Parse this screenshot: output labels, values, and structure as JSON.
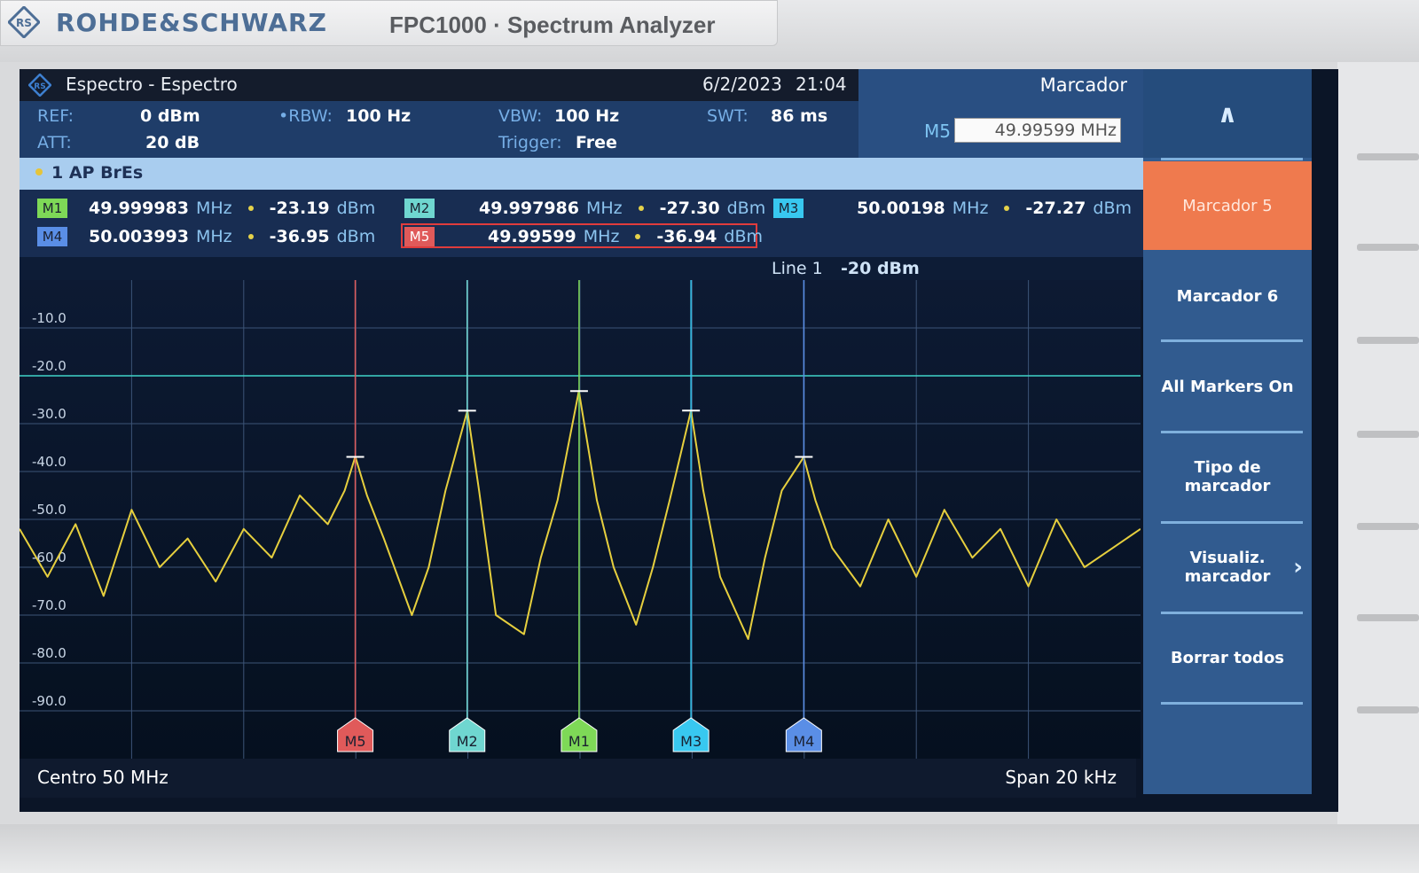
{
  "device": {
    "brand": "ROHDE&SCHWARZ",
    "model_title": "FPC1000 · Spectrum Analyzer"
  },
  "titlebar": {
    "title": "Espectro - Espectro",
    "date": "6/2/2023",
    "time": "21:04"
  },
  "settings": {
    "ref_label": "REF:",
    "ref_value": "0 dBm",
    "att_label": "ATT:",
    "att_value": "20 dB",
    "rbw_label": "•RBW:",
    "rbw_value": "100 Hz",
    "vbw_label": "VBW:",
    "vbw_value": "100 Hz",
    "trigger_label": "Trigger:",
    "trigger_value": "Free",
    "swt_label": "SWT:",
    "swt_value": "86 ms"
  },
  "marker_panel": {
    "title": "Marcador",
    "active_marker": "M5",
    "frequency_value": "49.99599 MHz"
  },
  "trace": {
    "label": "1 AP  BrEs"
  },
  "markers": [
    {
      "id": "M1",
      "freq": "49.999983",
      "freq_unit": "MHz",
      "level": "-23.19",
      "level_unit": "dBm",
      "color": "#7ed957"
    },
    {
      "id": "M2",
      "freq": "49.997986",
      "freq_unit": "MHz",
      "level": "-27.30",
      "level_unit": "dBm",
      "color": "#6fd6d0"
    },
    {
      "id": "M3",
      "freq": "50.00198",
      "freq_unit": "MHz",
      "level": "-27.27",
      "level_unit": "dBm",
      "color": "#38c8f0"
    },
    {
      "id": "M4",
      "freq": "50.003993",
      "freq_unit": "MHz",
      "level": "-36.95",
      "level_unit": "dBm",
      "color": "#5a8ee6"
    },
    {
      "id": "M5",
      "freq": "49.99599",
      "freq_unit": "MHz",
      "level": "-36.94",
      "level_unit": "dBm",
      "color": "#e05a5a"
    }
  ],
  "line_info": {
    "name": "Line 1",
    "value": "-20 dBm"
  },
  "footer": {
    "center": "Centro 50 MHz",
    "span": "Span 20 kHz"
  },
  "softkeys": {
    "up": "∧",
    "marker5": "Marcador 5",
    "marker6": "Marcador 6",
    "all_on": "All Markers On",
    "type": "Tipo de marcador",
    "display": "Visualiz. marcador",
    "display_arrow": "›",
    "clear": "Borrar todos"
  },
  "chart_data": {
    "type": "line",
    "title": "",
    "xlabel": "",
    "ylabel": "",
    "y_ticks": [
      "-10.0",
      "-20.0",
      "-30.0",
      "-40.0",
      "-50.0",
      "-60.0",
      "-70.0",
      "-80.0",
      "-90.0"
    ],
    "ylim": [
      0,
      -100
    ],
    "xlim_mhz": [
      49.99,
      50.01
    ],
    "grid": true,
    "display_line_dbm": -20,
    "series": [
      {
        "color": "#e6cf3e",
        "x_mhz": [
          49.99,
          49.9905,
          49.991,
          49.9915,
          49.992,
          49.9925,
          49.993,
          49.9935,
          49.994,
          49.9945,
          49.995,
          49.9955,
          49.9958,
          49.99599,
          49.9962,
          49.9965,
          49.997,
          49.9973,
          49.9976,
          49.99799,
          49.9982,
          49.9985,
          49.999,
          49.9993,
          49.9996,
          49.99998,
          50.0003,
          50.0006,
          50.001,
          50.0013,
          50.0016,
          50.00198,
          50.0022,
          50.0025,
          50.003,
          50.0033,
          50.0036,
          50.00399,
          50.0042,
          50.0045,
          50.005,
          50.0055,
          50.006,
          50.0065,
          50.007,
          50.0075,
          50.008,
          50.0085,
          50.009,
          50.0095,
          50.01
        ],
        "y_dbm": [
          -52,
          -62,
          -51,
          -66,
          -48,
          -60,
          -54,
          -63,
          -52,
          -58,
          -45,
          -51,
          -44,
          -36.9,
          -45,
          -54,
          -70,
          -60,
          -44,
          -27.3,
          -44,
          -70,
          -74,
          -58,
          -46,
          -23.2,
          -46,
          -60,
          -72,
          -60,
          -46,
          -27.3,
          -44,
          -62,
          -75,
          -58,
          -44,
          -37.0,
          -46,
          -56,
          -64,
          -50,
          -62,
          -48,
          -58,
          -52,
          -64,
          -50,
          -60,
          -56,
          -52
        ]
      }
    ],
    "markers": [
      {
        "id": "M5",
        "x_mhz": 49.99599,
        "y_dbm": -36.94
      },
      {
        "id": "M2",
        "x_mhz": 49.997986,
        "y_dbm": -27.3
      },
      {
        "id": "M1",
        "x_mhz": 49.999983,
        "y_dbm": -23.19
      },
      {
        "id": "M3",
        "x_mhz": 50.00198,
        "y_dbm": -27.27
      },
      {
        "id": "M4",
        "x_mhz": 50.003993,
        "y_dbm": -36.95
      }
    ]
  }
}
